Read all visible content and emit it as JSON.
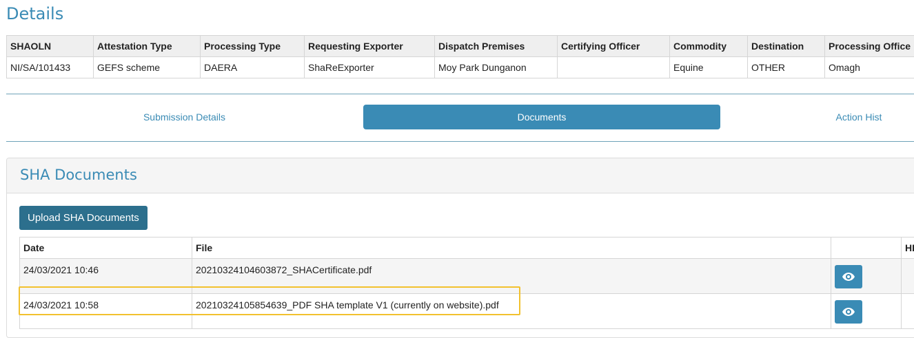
{
  "page": {
    "title": "Details"
  },
  "details": {
    "headers": [
      "SHAOLN",
      "Attestation Type",
      "Processing Type",
      "Requesting Exporter",
      "Dispatch Premises",
      "Certifying Officer",
      "Commodity",
      "Destination",
      "Processing Office"
    ],
    "row": [
      "NI/SA/101433",
      "GEFS scheme",
      "DAERA",
      "ShaReExporter",
      "Moy Park Dunganon",
      "",
      "Equine",
      "OTHER",
      "Omagh"
    ]
  },
  "tabs": [
    {
      "label": "Submission Details",
      "active": false
    },
    {
      "label": "Documents",
      "active": true
    },
    {
      "label": "Action Hist",
      "active": false
    }
  ],
  "documents": {
    "title": "SHA Documents",
    "upload_label": "Upload SHA Documents",
    "columns": [
      "Date",
      "File",
      "",
      "HI"
    ],
    "rows": [
      {
        "date": "24/03/2021 10:46",
        "file": "20210324104603872_SHACertificate.pdf",
        "action_icon": "eye-icon"
      },
      {
        "date": "24/03/2021 10:58",
        "file": "20210324105854639_PDF SHA template V1 (currently on website).pdf",
        "action_icon": "eye-icon"
      }
    ]
  },
  "colors": {
    "accent": "#3a8bb5",
    "button_dark": "#2c6f8d",
    "highlight": "#f2c12e"
  }
}
